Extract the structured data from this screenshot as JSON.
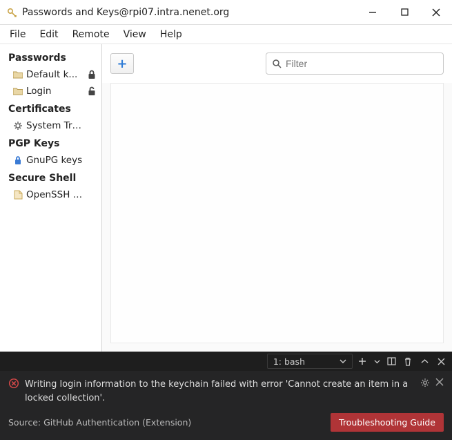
{
  "window": {
    "title": "Passwords and Keys@rpi07.intra.nenet.org"
  },
  "menubar": {
    "items": [
      "File",
      "Edit",
      "Remote",
      "View",
      "Help"
    ]
  },
  "sidebar": {
    "sections": [
      {
        "title": "Passwords",
        "items": [
          {
            "label": "Default k...",
            "icon": "folder",
            "locked": true
          },
          {
            "label": "Login",
            "icon": "folder",
            "locked": "open"
          }
        ]
      },
      {
        "title": "Certificates",
        "items": [
          {
            "label": "System Trust",
            "icon": "gear",
            "locked": false
          }
        ]
      },
      {
        "title": "PGP Keys",
        "items": [
          {
            "label": "GnuPG keys",
            "icon": "pgp",
            "locked": false
          }
        ]
      },
      {
        "title": "Secure Shell",
        "items": [
          {
            "label": "OpenSSH keys",
            "icon": "file",
            "locked": false
          }
        ]
      }
    ]
  },
  "toolbar": {
    "add_label": "+",
    "filter_placeholder": "Filter"
  },
  "terminal": {
    "dropdown_label": "1: bash"
  },
  "notification": {
    "message": "Writing login information to the keychain failed with error 'Cannot create an item in a locked collection'.",
    "source_label": "Source: GitHub Authentication (Extension)",
    "button_label": "Troubleshooting Guide"
  }
}
